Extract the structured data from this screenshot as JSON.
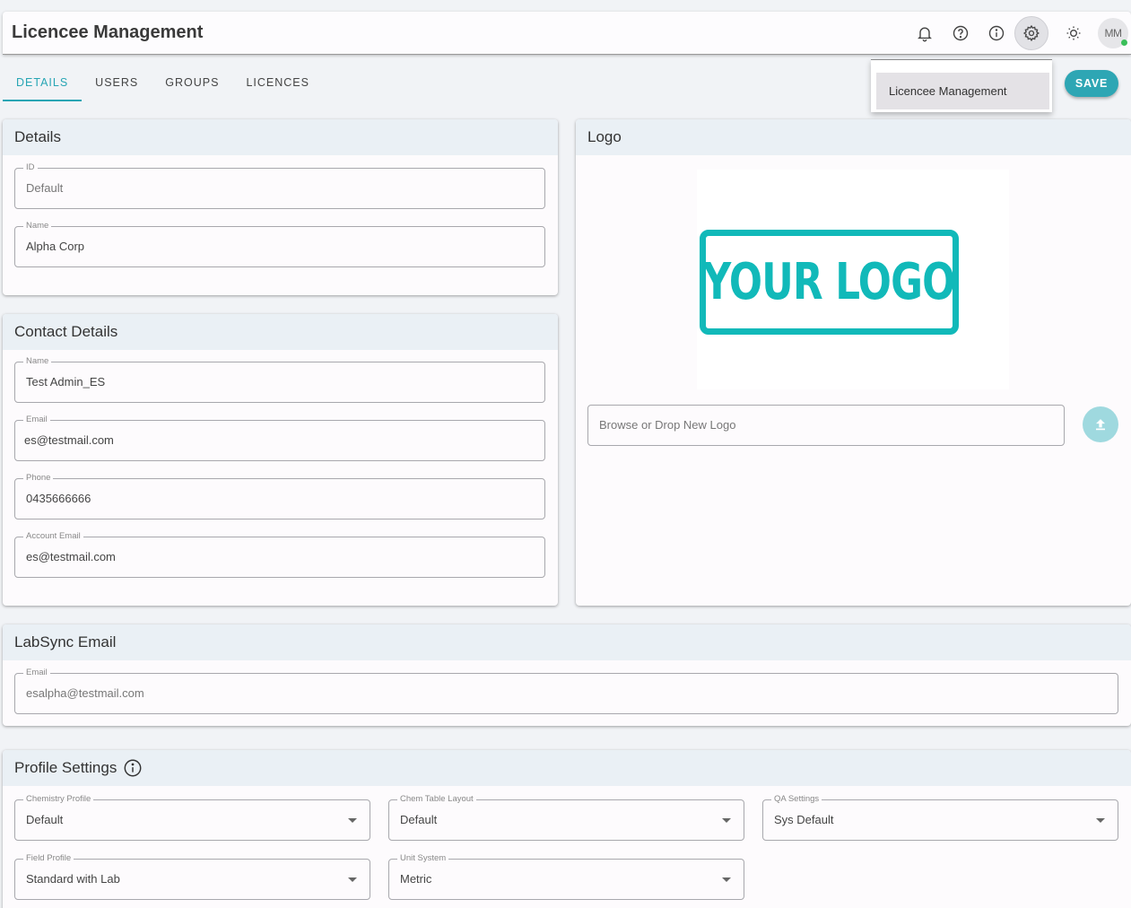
{
  "app": {
    "title": "Licencee Management"
  },
  "header": {
    "icons": [
      "bell-icon",
      "help-icon",
      "info-icon",
      "gear-icon",
      "brightness-icon"
    ],
    "avatar_initials": "MM",
    "status_color": "#3bbf5a"
  },
  "tabs": [
    {
      "label": "DETAILS",
      "active": true
    },
    {
      "label": "USERS",
      "active": false
    },
    {
      "label": "GROUPS",
      "active": false
    },
    {
      "label": "LICENCES",
      "active": false
    }
  ],
  "settings_menu": {
    "items": [
      {
        "label": "Licencee Management"
      }
    ]
  },
  "actions": {
    "save_label": "SAVE"
  },
  "colors": {
    "accent": "#27a5b4",
    "logo": "#11b9b9"
  },
  "details": {
    "title": "Details",
    "fields": [
      {
        "label": "ID",
        "value": "Default"
      },
      {
        "label": "Name",
        "value": "Alpha Corp"
      }
    ]
  },
  "contact": {
    "title": "Contact Details",
    "fields": [
      {
        "label": "Name",
        "value": "Test Admin_ES"
      },
      {
        "label": "Email",
        "value": "es@testmail.com"
      },
      {
        "label": "Phone",
        "value": "0435666666"
      },
      {
        "label": "Account Email",
        "value": "es@testmail.com"
      }
    ]
  },
  "logo": {
    "title": "Logo",
    "image_text": "YOUR LOGO",
    "upload_placeholder": "Browse or Drop New Logo"
  },
  "labsync": {
    "title": "LabSync Email",
    "field": {
      "label": "Email",
      "value": "esalpha@testmail.com"
    }
  },
  "profile": {
    "title": "Profile Settings",
    "selects": [
      {
        "label": "Chemistry Profile",
        "value": "Default"
      },
      {
        "label": "Chem Table Layout",
        "value": "Default"
      },
      {
        "label": "QA Settings",
        "value": "Sys Default"
      },
      {
        "label": "Field Profile",
        "value": "Standard with Lab"
      },
      {
        "label": "Unit System",
        "value": "Metric"
      }
    ]
  }
}
